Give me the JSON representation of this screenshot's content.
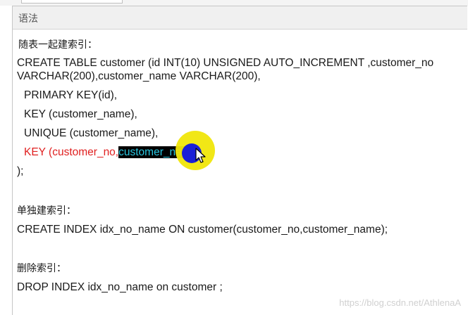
{
  "panel": {
    "title": "语法"
  },
  "content": {
    "section1_heading": "随表一起建索引：",
    "create_line1": "CREATE TABLE customer (id INT(10) UNSIGNED  AUTO_INCREMENT ,customer_no",
    "create_line2": "VARCHAR(200),customer_name VARCHAR(200),",
    "primary_key": "PRIMARY KEY(id),",
    "key_line": "KEY (customer_name),",
    "unique_line": "UNIQUE (customer_name),",
    "key2_prefix": "KEY (customer_no,",
    "key2_selected": "customer_name",
    "key2_suffix": ")",
    "close_paren": ");",
    "section2_heading": "单独建索引：",
    "create_index": "CREATE  INDEX idx_no_name ON customer(customer_no,customer_name);",
    "section3_heading": "删除索引：",
    "drop_index": "DROP INDEX idx_no_name  on customer ;"
  },
  "watermark": "https://blog.csdn.net/AthlenaA",
  "colors": {
    "highlight_key": "#e02020",
    "selection_bg": "#000000",
    "selection_text": "#29c6e0",
    "cursor_ring": "#f0e60a",
    "cursor_dot": "#1a1fd6"
  }
}
